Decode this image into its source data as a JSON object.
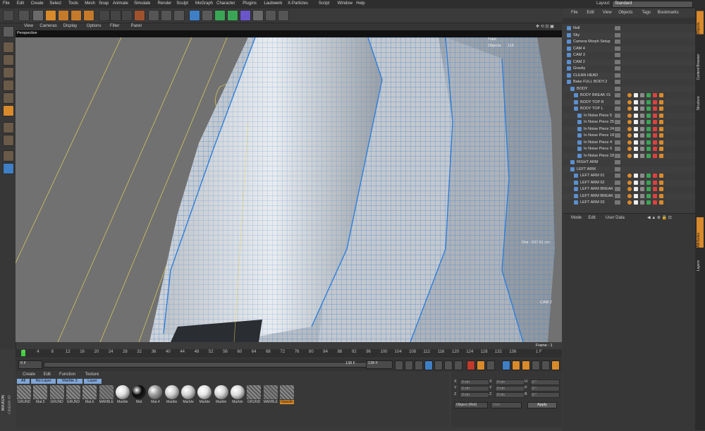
{
  "menubar": {
    "items": [
      "File",
      "Edit",
      "Create",
      "Select",
      "Tools",
      "Mesh",
      "Snap",
      "Animate",
      "Simulate",
      "Render",
      "Sculpt",
      "MoGraph",
      "Character",
      "Plugins",
      "Laubwerk",
      "X-Particles",
      "Script",
      "Window",
      "Help"
    ],
    "layout_label": "Layout:",
    "layout_value": "Standard"
  },
  "viewport": {
    "menu": [
      "View",
      "Cameras",
      "Display",
      "Options",
      "Filter",
      "Panel"
    ],
    "name": "Perspective",
    "stats_total": "Total",
    "stats_objects": "Objects",
    "stats_objects_count": "115",
    "distance": "Dist : 637.61 cm",
    "camera": "CAM 2",
    "frame": "Frame : 1"
  },
  "timeline": {
    "ticks": [
      "0",
      "4",
      "8",
      "12",
      "16",
      "20",
      "24",
      "28",
      "32",
      "36",
      "40",
      "44",
      "48",
      "52",
      "56",
      "60",
      "64",
      "68",
      "72",
      "76",
      "80",
      "84",
      "88",
      "92",
      "96",
      "100",
      "104",
      "108",
      "112",
      "116",
      "120",
      "124",
      "128",
      "132",
      "136",
      "1 F"
    ]
  },
  "transport": {
    "start": "0 F",
    "current": "0 F",
    "end_field": "138 F",
    "end_field2": "138 F"
  },
  "material_manager": {
    "menu": [
      "Create",
      "Edit",
      "Function",
      "Texture"
    ],
    "filters": [
      "All",
      "No Layer",
      "Marble 3",
      "Layer"
    ],
    "materials": [
      {
        "name": "GRUND",
        "color": "#8a8a8a"
      },
      {
        "name": "Mat.5",
        "color": "#8e8e8e"
      },
      {
        "name": "GRUND",
        "color": "#858585"
      },
      {
        "name": "GRUND",
        "color": "#8a8a8a"
      },
      {
        "name": "Mat.6",
        "color": "#8e8e8e"
      },
      {
        "name": "MARBLE",
        "color": "#7c7c7c"
      },
      {
        "name": "Marble",
        "color": "#e0e0e0"
      },
      {
        "name": "Mat",
        "color": "#0a0a0a"
      },
      {
        "name": "Mat.4",
        "color": "#9a9a9a"
      },
      {
        "name": "Marble",
        "color": "#cfcfcf"
      },
      {
        "name": "Marble",
        "color": "#d2d2d2"
      },
      {
        "name": "Marble",
        "color": "#e4e4e4"
      },
      {
        "name": "Marble",
        "color": "#d6d6d6"
      },
      {
        "name": "Marble",
        "color": "#dcdcdc"
      },
      {
        "name": "GRUND",
        "color": "#8a8a8a"
      },
      {
        "name": "MARBLE",
        "color": "#7f7f7f"
      },
      {
        "name": "Glasslin",
        "color": "#8a8a8a"
      }
    ]
  },
  "coordinates": {
    "rows": [
      {
        "a": "X",
        "av": "0 cm",
        "b": "X",
        "bv": "0 cm",
        "c": "H",
        "cv": "0 °"
      },
      {
        "a": "Y",
        "av": "0 cm",
        "b": "Y",
        "bv": "0 cm",
        "c": "P",
        "cv": "0 °"
      },
      {
        "a": "Z",
        "av": "0 cm",
        "b": "Z",
        "bv": "0 cm",
        "c": "B",
        "cv": "0 °"
      }
    ],
    "mode": "Object (Rel)",
    "size": "Size",
    "apply": "Apply"
  },
  "object_manager": {
    "menu": [
      "File",
      "Edit",
      "View",
      "Objects",
      "Tags",
      "Bookmarks"
    ],
    "objects": [
      {
        "name": "Null",
        "indent": 0
      },
      {
        "name": "Sky",
        "indent": 0
      },
      {
        "name": "Camera Morph Setup",
        "indent": 0
      },
      {
        "name": "CAM 4",
        "indent": 0
      },
      {
        "name": "CAM 3",
        "indent": 0
      },
      {
        "name": "CAM 2",
        "indent": 0
      },
      {
        "name": "Gravity",
        "indent": 0
      },
      {
        "name": "CLEAN HEAD",
        "indent": 0
      },
      {
        "name": "Bake FULL BODY.2",
        "indent": 0
      },
      {
        "name": "BODY",
        "indent": 1
      },
      {
        "name": "BODY BREAK 01",
        "indent": 2
      },
      {
        "name": "BODY TOP R",
        "indent": 2
      },
      {
        "name": "BODY TOP L",
        "indent": 2
      },
      {
        "name": "In Noise Piece 5",
        "indent": 3
      },
      {
        "name": "In Noise Piece 25",
        "indent": 3
      },
      {
        "name": "In Noise Piece 24",
        "indent": 3
      },
      {
        "name": "In Noise Piece 18",
        "indent": 3
      },
      {
        "name": "In Noise Piece 4",
        "indent": 3
      },
      {
        "name": "In Noise Piece 9",
        "indent": 3
      },
      {
        "name": "In Noise Piece 18",
        "indent": 3
      },
      {
        "name": "RIGHT ARM",
        "indent": 1
      },
      {
        "name": "LEFT ARM",
        "indent": 1
      },
      {
        "name": "LEFT ARM 01",
        "indent": 2
      },
      {
        "name": "LEFT ARM 02",
        "indent": 2
      },
      {
        "name": "LEFT ARM BREAK",
        "indent": 2
      },
      {
        "name": "LEFT ARM BREAK",
        "indent": 2
      },
      {
        "name": "LEFT ARM 03",
        "indent": 2
      }
    ]
  },
  "attribute_manager": {
    "menu": [
      "Mode",
      "Edit",
      "User Data"
    ]
  },
  "right_tabs": [
    "Objects",
    "Content Browser",
    "Structure",
    "Attributes",
    "Layers"
  ],
  "branding": {
    "line1": "MAXON",
    "line2": "CINEMA 4D"
  }
}
